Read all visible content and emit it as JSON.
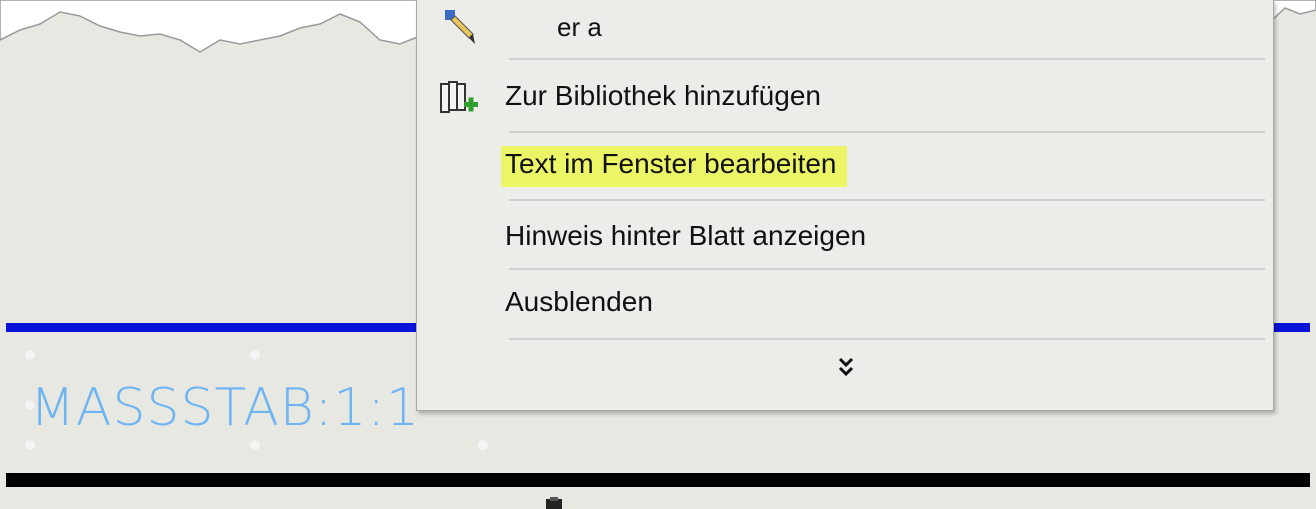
{
  "drawing": {
    "scale_label": "MASSSTAB:1:1",
    "colors": {
      "background": "#e8e8e3",
      "blue_line": "#0a14d8",
      "scale_text": "#6fb4f2"
    }
  },
  "context_menu": {
    "partial_top_item": "er a",
    "items": [
      {
        "label": "Zur Bibliothek hinzufügen",
        "icon": "library-add-icon"
      },
      {
        "label": "Text im Fenster bearbeiten",
        "highlighted": true
      },
      {
        "label": "Hinweis hinter Blatt anzeigen"
      },
      {
        "label": "Ausblenden"
      }
    ],
    "more_icon": "double-chevron-down-icon",
    "highlight_color": "#ebf565"
  }
}
